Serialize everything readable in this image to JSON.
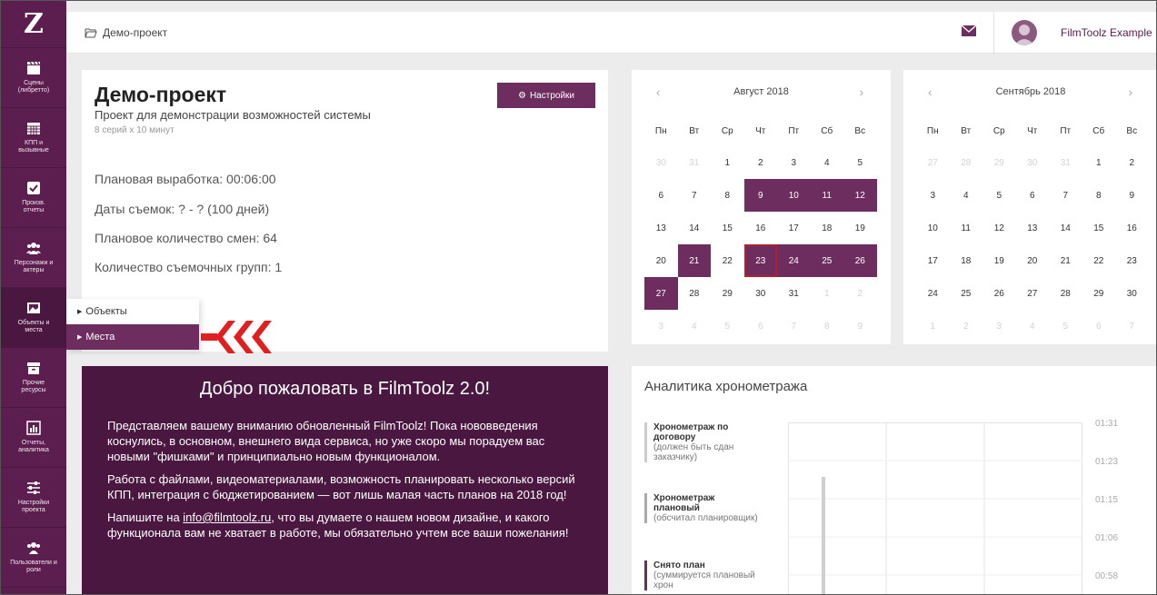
{
  "logo": "Z",
  "sidebar": {
    "items": [
      {
        "label": "Сцены\n(либретто)",
        "icon": "clapperboard-icon"
      },
      {
        "label": "КПП и\nвызывные",
        "icon": "calendar-grid-icon"
      },
      {
        "label": "Произв.\nотчеты",
        "icon": "checkbox-icon"
      },
      {
        "label": "Персонажи и\nактеры",
        "icon": "people-icon"
      },
      {
        "label": "Объекты и\nместа",
        "icon": "image-icon"
      },
      {
        "label": "Прочие\nресурсы",
        "icon": "archive-box-icon"
      },
      {
        "label": "Отчеты,\nаналитика",
        "icon": "bar-chart-icon"
      },
      {
        "label": "Настройки\nпроекта",
        "icon": "sliders-icon"
      },
      {
        "label": "Пользователи и\nроли",
        "icon": "users-icon"
      }
    ]
  },
  "submenu": {
    "items": [
      {
        "label": "Объекты"
      },
      {
        "label": "Места"
      }
    ]
  },
  "topbar": {
    "breadcrumb": "Демо-проект",
    "username": "FilmToolz Example"
  },
  "project": {
    "title": "Демо-проект",
    "description": "Проект для демонстрации возможностей системы",
    "episodes": "8 серий x 10 минут",
    "settings_label": "Настройки",
    "stats": [
      "Плановая выработка: 00:06:00",
      "Даты съемок: ? - ? (100 дней)",
      "Плановое количество смен: 64",
      "Количество съемочных групп: 1"
    ]
  },
  "welcome": {
    "title": "Добро пожаловать в FilmToolz 2.0!",
    "p1": "Представляем вашему вниманию обновленный FilmToolz! Пока нововведения коснулись, в основном, внешнего вида сервиса, но уже скоро мы порадуем вас новыми \"фишками\" и принципиально новым функционалом.",
    "p2": "Работа с файлами, видеоматериалами, возможность планировать несколько версий КПП, интеграция с бюджетированием — вот лишь малая часть планов на 2018 год!",
    "p3_before": "Напишите на ",
    "p3_email": "info@filmtoolz.ru",
    "p3_after": ", что вы думаете о нашем новом дизайне, и какого функционала вам не хватает в работе, мы обязательно учтем все ваши пожелания!"
  },
  "weekdays": [
    "Пн",
    "Вт",
    "Ср",
    "Чт",
    "Пт",
    "Сб",
    "Вс"
  ],
  "calendars": [
    {
      "title": "Август 2018",
      "weeks": [
        [
          [
            "30",
            "m"
          ],
          [
            "31",
            "m"
          ],
          [
            "1",
            ""
          ],
          [
            "2",
            ""
          ],
          [
            "3",
            ""
          ],
          [
            "4",
            ""
          ],
          [
            "5",
            ""
          ]
        ],
        [
          [
            "6",
            ""
          ],
          [
            "7",
            ""
          ],
          [
            "8",
            ""
          ],
          [
            "9",
            "s"
          ],
          [
            "10",
            "s"
          ],
          [
            "11",
            "s"
          ],
          [
            "12",
            "s"
          ]
        ],
        [
          [
            "13",
            ""
          ],
          [
            "14",
            ""
          ],
          [
            "15",
            ""
          ],
          [
            "16",
            ""
          ],
          [
            "17",
            ""
          ],
          [
            "18",
            ""
          ],
          [
            "19",
            ""
          ]
        ],
        [
          [
            "20",
            ""
          ],
          [
            "21",
            "s"
          ],
          [
            "22",
            ""
          ],
          [
            "23",
            "t"
          ],
          [
            "24",
            "s"
          ],
          [
            "25",
            "s"
          ],
          [
            "26",
            "s"
          ]
        ],
        [
          [
            "27",
            "s"
          ],
          [
            "28",
            ""
          ],
          [
            "29",
            ""
          ],
          [
            "30",
            ""
          ],
          [
            "31",
            ""
          ],
          [
            "1",
            "m"
          ],
          [
            "2",
            "m"
          ]
        ],
        [
          [
            "3",
            "m"
          ],
          [
            "4",
            "m"
          ],
          [
            "5",
            "m"
          ],
          [
            "6",
            "m"
          ],
          [
            "7",
            "m"
          ],
          [
            "8",
            "m"
          ],
          [
            "9",
            "m"
          ]
        ]
      ]
    },
    {
      "title": "Сентябрь 2018",
      "weeks": [
        [
          [
            "27",
            "m"
          ],
          [
            "28",
            "m"
          ],
          [
            "29",
            "m"
          ],
          [
            "30",
            "m"
          ],
          [
            "31",
            "m"
          ],
          [
            "1",
            ""
          ],
          [
            "2",
            ""
          ]
        ],
        [
          [
            "3",
            ""
          ],
          [
            "4",
            ""
          ],
          [
            "5",
            ""
          ],
          [
            "6",
            ""
          ],
          [
            "7",
            ""
          ],
          [
            "8",
            ""
          ],
          [
            "9",
            ""
          ]
        ],
        [
          [
            "10",
            ""
          ],
          [
            "11",
            ""
          ],
          [
            "12",
            ""
          ],
          [
            "13",
            ""
          ],
          [
            "14",
            ""
          ],
          [
            "15",
            ""
          ],
          [
            "16",
            ""
          ]
        ],
        [
          [
            "17",
            ""
          ],
          [
            "18",
            ""
          ],
          [
            "19",
            ""
          ],
          [
            "20",
            ""
          ],
          [
            "21",
            ""
          ],
          [
            "22",
            ""
          ],
          [
            "23",
            ""
          ]
        ],
        [
          [
            "24",
            ""
          ],
          [
            "25",
            ""
          ],
          [
            "26",
            ""
          ],
          [
            "27",
            ""
          ],
          [
            "28",
            ""
          ],
          [
            "29",
            ""
          ],
          [
            "30",
            ""
          ]
        ],
        [
          [
            "1",
            "m"
          ],
          [
            "2",
            "m"
          ],
          [
            "3",
            "m"
          ],
          [
            "4",
            "m"
          ],
          [
            "5",
            "m"
          ],
          [
            "6",
            "m"
          ],
          [
            "7",
            "m"
          ]
        ]
      ]
    }
  ],
  "analytics": {
    "title": "Аналитика хронометража",
    "legend": [
      {
        "bold": "Хронометраж по договору",
        "note": "(должен быть сдан заказчику)"
      },
      {
        "bold": "Хронометраж плановый",
        "note": "(обсчитал планировщик)"
      },
      {
        "bold": "Снято план",
        "note": "(суммируется плановый хрон"
      }
    ],
    "yticks": [
      "01:31",
      "01:23",
      "01:15",
      "01:06",
      "00:58"
    ]
  },
  "colors": {
    "sidebar": "#5b1e4f",
    "accent": "#6d2e5f",
    "welcome_bg": "#4a1740",
    "today_border": "#b02030",
    "arrow": "#e02020"
  }
}
